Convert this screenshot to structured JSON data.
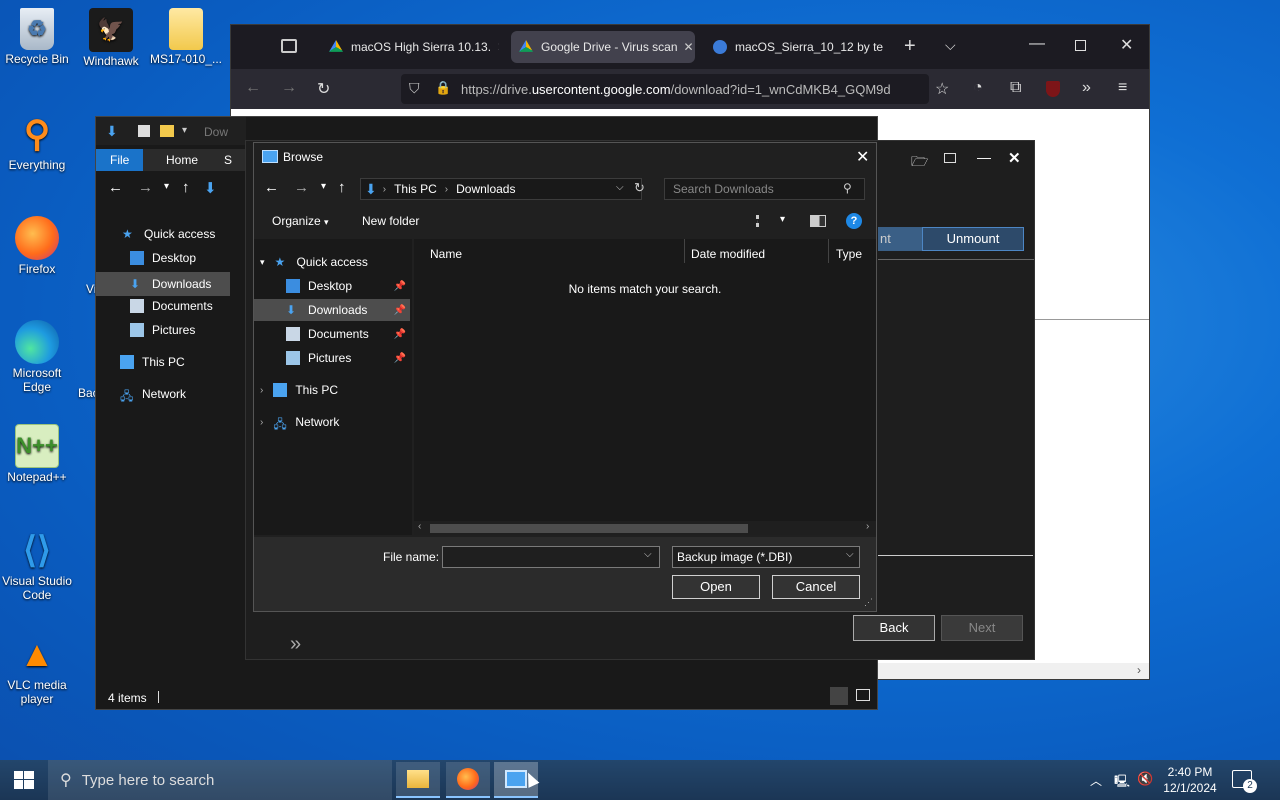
{
  "desktop": {
    "icons": [
      {
        "label": "Recycle Bin",
        "icon": "recycle-bin-icon"
      },
      {
        "label": "Windhawk",
        "icon": "windhawk-icon"
      },
      {
        "label": "MS17-010_...",
        "icon": "folder-icon"
      },
      {
        "label": "Everything",
        "icon": "everything-search-icon"
      },
      {
        "label": "Firefox",
        "icon": "firefox-icon"
      },
      {
        "label": "Microsoft Edge",
        "icon": "edge-icon"
      },
      {
        "label": "Notepad++",
        "icon": "notepadpp-icon"
      },
      {
        "label": "Visual Studio Code",
        "icon": "vscode-icon"
      },
      {
        "label": "VLC media player",
        "icon": "vlc-icon"
      }
    ],
    "partial_labels": [
      "Vi",
      "Bac"
    ]
  },
  "browser": {
    "tabs": [
      {
        "label": "macOS High Sierra 10.13.",
        "active": false
      },
      {
        "label": "Google Drive - Virus scan",
        "active": true
      },
      {
        "label": "macOS_Sierra_10_12 by te",
        "active": false
      }
    ],
    "url_prefix": "https://drive.",
    "url_domain": "usercontent.google.com",
    "url_suffix": "/download?id=1_wnCdMKB4_GQM9d"
  },
  "explorer": {
    "title_partial": "Dow",
    "ribbon_tabs": [
      "File",
      "Home",
      "S"
    ],
    "nav": [
      {
        "label": "Quick access"
      },
      {
        "label": "Desktop"
      },
      {
        "label": "Downloads"
      },
      {
        "label": "Documents"
      },
      {
        "label": "Pictures"
      },
      {
        "label": "This PC"
      },
      {
        "label": "Network"
      }
    ],
    "status": "4 items"
  },
  "app": {
    "unmount_partial": "nt",
    "unmount": "Unmount",
    "back": "Back",
    "next": "Next"
  },
  "dialog": {
    "title": "Browse",
    "breadcrumb": [
      "This PC",
      "Downloads"
    ],
    "search_placeholder": "Search Downloads",
    "organize": "Organize",
    "new_folder": "New folder",
    "tree": [
      {
        "label": "Quick access"
      },
      {
        "label": "Desktop"
      },
      {
        "label": "Downloads"
      },
      {
        "label": "Documents"
      },
      {
        "label": "Pictures"
      },
      {
        "label": "This PC"
      },
      {
        "label": "Network"
      }
    ],
    "columns": [
      "Name",
      "Date modified",
      "Type"
    ],
    "empty_message": "No items match your search.",
    "file_name_label": "File name:",
    "file_name_value": "",
    "file_type": "Backup image (*.DBI)",
    "open": "Open",
    "cancel": "Cancel"
  },
  "taskbar": {
    "search_placeholder": "Type here to search",
    "time": "2:40 PM",
    "date": "12/1/2024",
    "notification_count": "2"
  }
}
